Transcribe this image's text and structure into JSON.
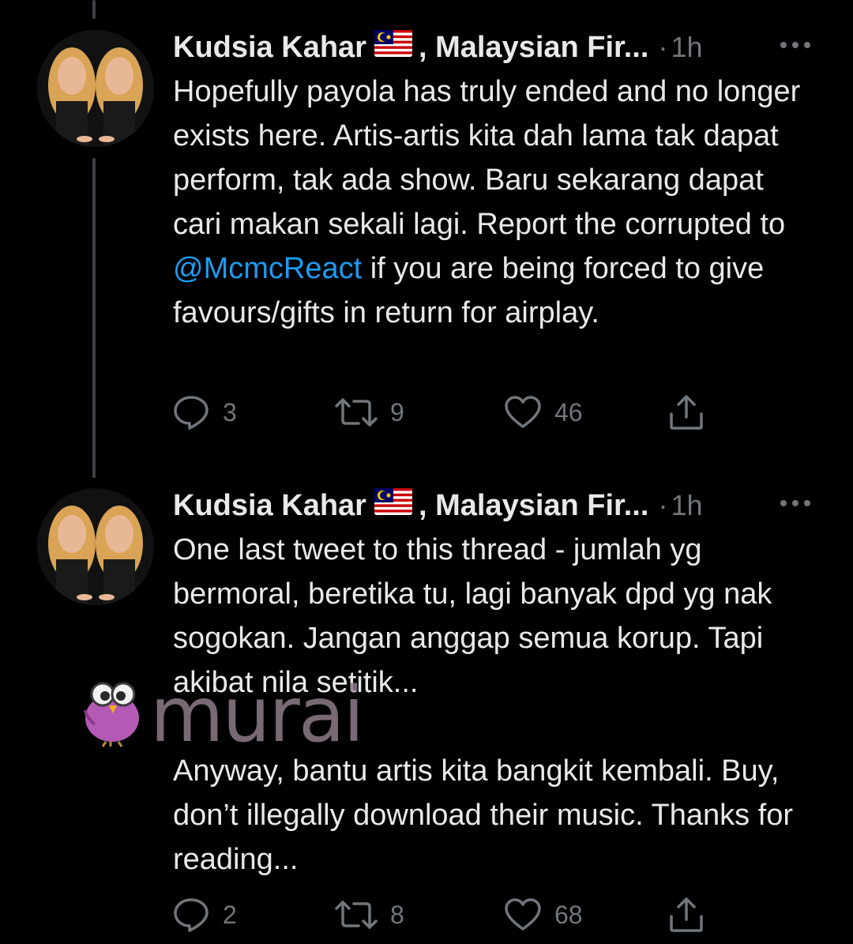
{
  "colors": {
    "background": "#000000",
    "text": "#e7e9ea",
    "secondary": "#71767b",
    "mention": "#1d9bf0",
    "thread_line": "#3e4144",
    "watermark": "#8e7c8a"
  },
  "tweets": [
    {
      "author_name": "Kudsia Kahar",
      "author_flag": "malaysia-flag-icon",
      "display_suffix": ", Malaysian Fir...",
      "separator": "·",
      "time": "1h",
      "text_before": "Hopefully payola has truly ended and no longer exists here. Artis-artis kita dah lama tak dapat perform, tak ada show. Baru sekarang dapat cari makan sekali lagi. Report the corrupted to ",
      "mention": "@McmcReact",
      "text_after": " if you are being forced to give favours/gifts in return for airplay.",
      "replies": "3",
      "retweets": "9",
      "likes": "46"
    },
    {
      "author_name": "Kudsia Kahar",
      "author_flag": "malaysia-flag-icon",
      "display_suffix": ", Malaysian Fir...",
      "separator": "·",
      "time": "1h",
      "text": "One last tweet to this thread - jumlah yg bermoral, beretika tu, lagi banyak dpd yg nak sogokan. Jangan anggap semua korup. Tapi akibat nila setitik...\n\nAnyway, bantu artis kita bangkit kembali. Buy, don’t illegally download their music. Thanks for reading...",
      "replies": "2",
      "retweets": "8",
      "likes": "68"
    }
  ],
  "watermark": {
    "text": "murai"
  }
}
